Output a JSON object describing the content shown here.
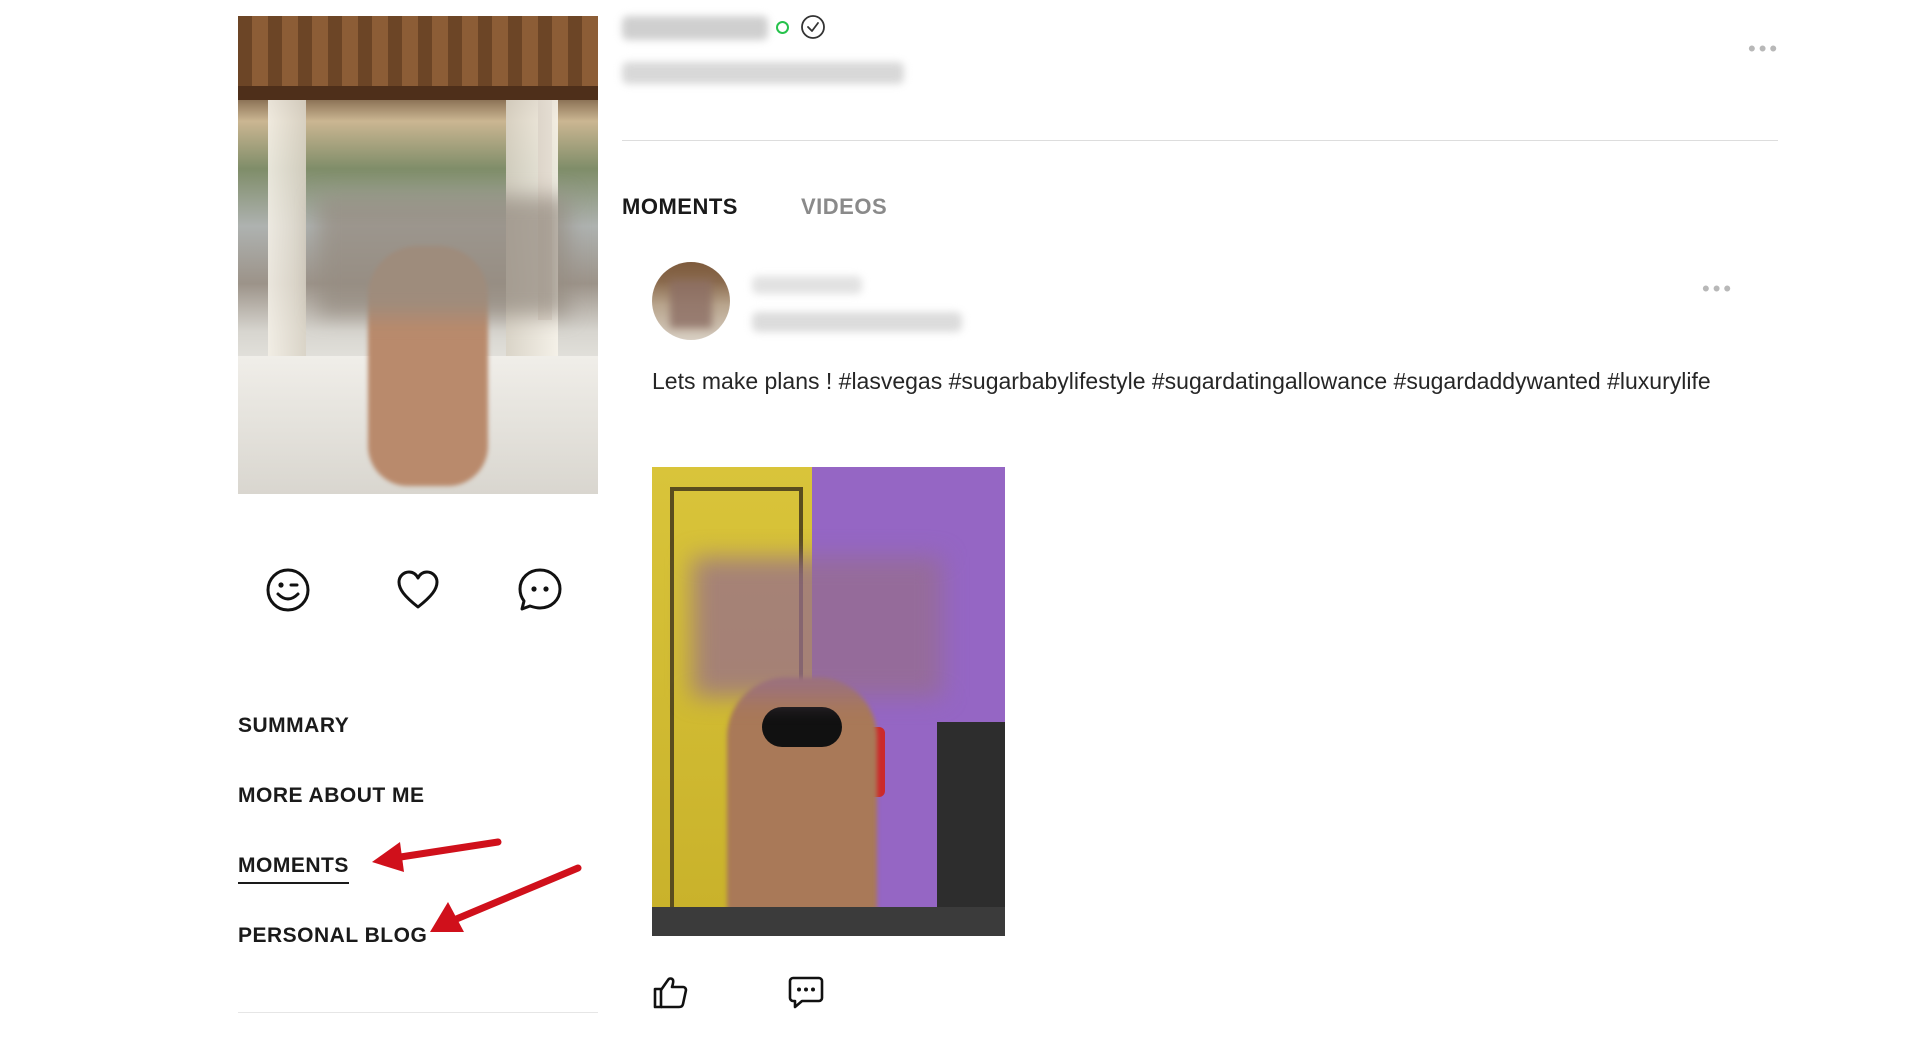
{
  "profile": {
    "online_status_color": "#27c24c",
    "verified_icon": "check-circle-icon"
  },
  "actions": [
    {
      "name": "wink",
      "icon": "wink-face-icon"
    },
    {
      "name": "favorite",
      "icon": "heart-icon"
    },
    {
      "name": "message",
      "icon": "chat-bubble-icon"
    }
  ],
  "side_nav": {
    "items": [
      {
        "label": "SUMMARY"
      },
      {
        "label": "MORE ABOUT ME"
      },
      {
        "label": "MOMENTS",
        "active": true
      },
      {
        "label": "PERSONAL BLOG"
      }
    ]
  },
  "tabs": [
    {
      "label": "MOMENTS",
      "active": true
    },
    {
      "label": "VIDEOS",
      "active": false
    }
  ],
  "post": {
    "text": "Lets make plans ! #lasvegas #sugarbabylifestyle  #sugardatingallowance  #sugardaddywanted #luxurylife"
  },
  "more_label": "•••",
  "accent_color": "#d0101b"
}
